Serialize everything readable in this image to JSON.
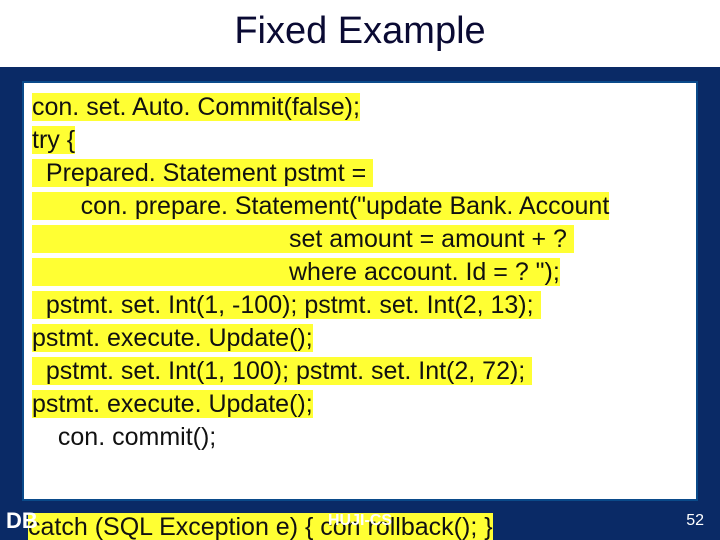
{
  "slide": {
    "title": "Fixed Example",
    "footer_left": "DB",
    "footer_center": "HUJI-CS",
    "page_number": "52"
  },
  "code": {
    "l1": "con. set. Auto. Commit(false);",
    "l2": "try {",
    "l3a": "  Prepared. Statement pstmt = ",
    "l3b": "       con. prepare. Statement(\"update Bank. Account",
    "l3c": "                                     set amount = amount + ? ",
    "l3d": "                                     where account. Id = ? \");",
    "l4": "  pstmt. set. Int(1, -100); pstmt. set. Int(2, 13); ",
    "l5": "pstmt. execute. Update();",
    "l6": "  pstmt. set. Int(1, 100); pstmt. set. Int(2, 72); ",
    "l7": "pstmt. execute. Update();",
    "l8": "  con. commit();",
    "cut": "catch (SQL Exception e) { con rollback();      }"
  }
}
